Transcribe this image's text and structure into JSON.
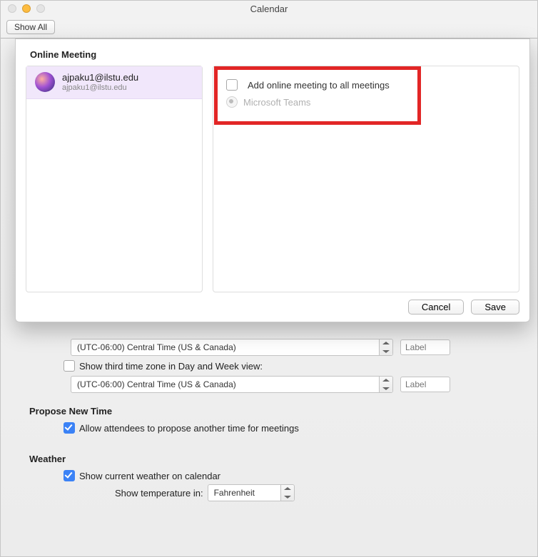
{
  "window": {
    "title": "Calendar",
    "show_all": "Show All"
  },
  "sheet": {
    "title": "Online Meeting",
    "account": {
      "display": "ajpaku1@ilstu.edu",
      "subtitle": "ajpaku1@ilstu.edu"
    },
    "option_add_all": "Add online meeting to all meetings",
    "option_teams": "Microsoft Teams",
    "cancel": "Cancel",
    "save": "Save"
  },
  "tz": {
    "value1": "(UTC-06:00) Central Time (US & Canada)",
    "label_ph": "Label",
    "third_zone": "Show third time zone in Day and Week view:",
    "value2": "(UTC-06:00) Central Time (US & Canada)"
  },
  "propose": {
    "title": "Propose New Time",
    "allow": "Allow attendees to propose another time for meetings"
  },
  "weather": {
    "title": "Weather",
    "show_current": "Show current weather on calendar",
    "temp_label": "Show temperature in:",
    "temp_unit": "Fahrenheit"
  }
}
